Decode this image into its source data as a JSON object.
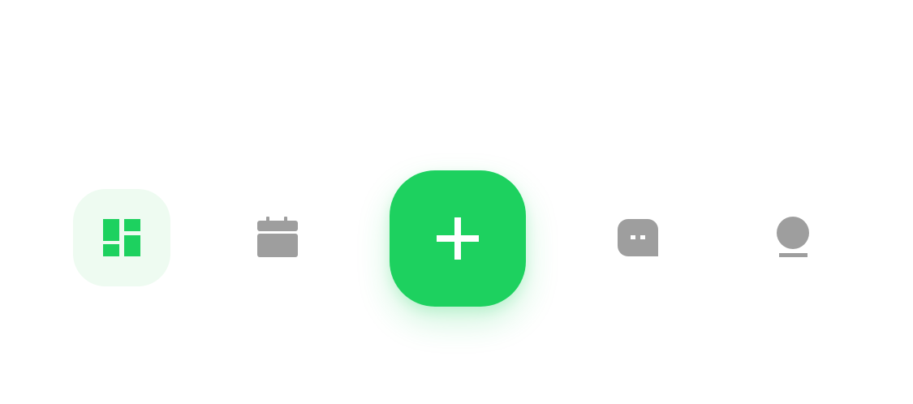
{
  "bottom_nav": {
    "active_tab": "dashboard",
    "accent_color": "#1dd15f",
    "active_bg_color": "#eefbf1",
    "inactive_icon_color": "#9e9e9e",
    "items": [
      {
        "id": "dashboard",
        "icon": "dashboard-icon",
        "active": true
      },
      {
        "id": "calendar",
        "icon": "calendar-icon",
        "active": false
      },
      {
        "id": "add",
        "icon": "plus-icon",
        "active": false
      },
      {
        "id": "messages",
        "icon": "chat-bubble-icon",
        "active": false
      },
      {
        "id": "profile",
        "icon": "user-icon",
        "active": false
      }
    ]
  }
}
